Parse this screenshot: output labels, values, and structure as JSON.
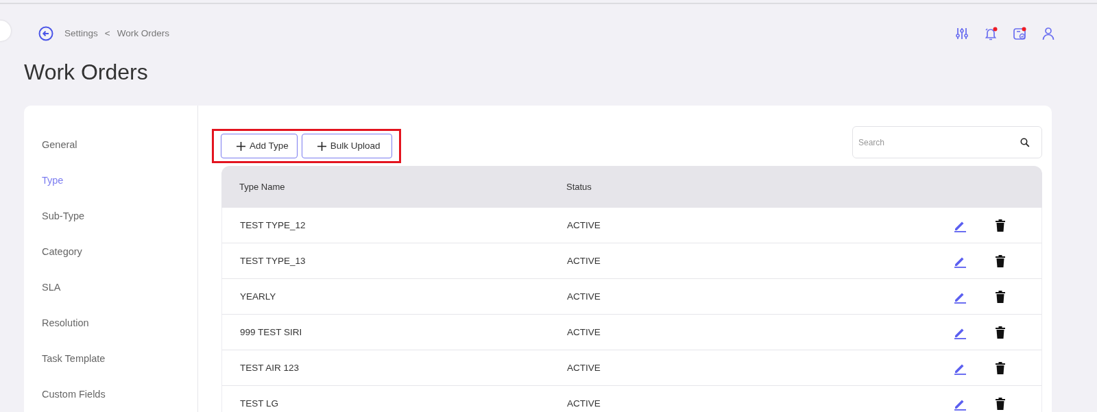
{
  "breadcrumb": [
    {
      "label": "Settings"
    },
    {
      "label": "Work Orders"
    }
  ],
  "breadcrumb_separator": "<",
  "page_title": "Work Orders",
  "header_icons": [
    {
      "kind": "filters",
      "alert": false
    },
    {
      "kind": "bell",
      "alert": true
    },
    {
      "kind": "tasks",
      "alert": true
    },
    {
      "kind": "user",
      "alert": false
    }
  ],
  "sidebar": {
    "items": [
      {
        "label": "General",
        "selected": false
      },
      {
        "label": "Type",
        "selected": true
      },
      {
        "label": "Sub-Type",
        "selected": false
      },
      {
        "label": "Category",
        "selected": false
      },
      {
        "label": "SLA",
        "selected": false
      },
      {
        "label": "Resolution",
        "selected": false
      },
      {
        "label": "Task Template",
        "selected": false
      },
      {
        "label": "Custom Fields",
        "selected": false
      }
    ]
  },
  "toolbar": {
    "buttons": [
      {
        "label": "Add Type"
      },
      {
        "label": "Bulk Upload"
      }
    ],
    "highlighted": true
  },
  "search": {
    "placeholder": "Search"
  },
  "table": {
    "columns": [
      "Type Name",
      "Status"
    ],
    "rows": [
      {
        "cells": [
          "TEST TYPE_12",
          "ACTIVE"
        ]
      },
      {
        "cells": [
          "TEST TYPE_13",
          "ACTIVE"
        ]
      },
      {
        "cells": [
          "YEARLY",
          "ACTIVE"
        ]
      },
      {
        "cells": [
          "999 TEST SIRI",
          "ACTIVE"
        ]
      },
      {
        "cells": [
          "TEST AIR 123",
          "ACTIVE"
        ]
      },
      {
        "cells": [
          "TEST LG",
          "ACTIVE"
        ]
      }
    ]
  }
}
